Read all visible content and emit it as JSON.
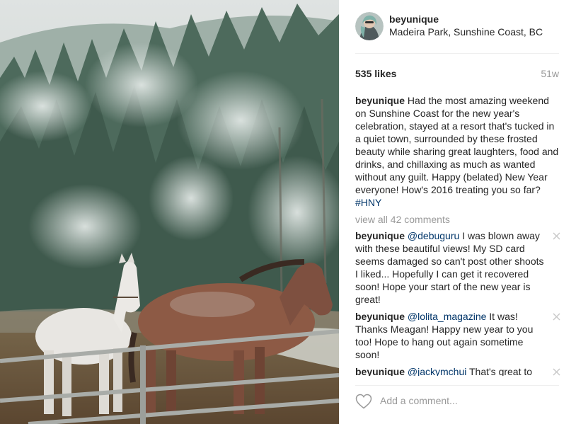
{
  "post": {
    "username": "beyunique",
    "location": "Madeira Park, Sunshine Coast, BC",
    "likes": "535 likes",
    "age": "51w",
    "photo_alt": "Two horses by a fence in front of a frosted forest"
  },
  "caption": {
    "username": "beyunique",
    "text": "Had the most amazing weekend on Sunshine Coast for the new year's celebration, stayed at a resort that's tucked in a quiet town, surrounded by these frosted beauty while sharing great laughters, food and drinks, and chillaxing as much as wanted without any guilt. Happy (belated) New Year everyone! How's 2016 treating you so far?",
    "hashtag": "#HNY"
  },
  "view_all_comments": "view all 42 comments",
  "comments": [
    {
      "username": "beyunique",
      "mention": "@debuguru",
      "text": "I was blown away with these beautiful views! My SD card seems damaged so can't post other shoots I liked... Hopefully I can get it recovered soon! Hope your start of the new year is great!"
    },
    {
      "username": "beyunique",
      "mention": "@lolita_magazine",
      "text": "It was! Thanks Meagan! Happy new year to you too! Hope to hang out again sometime soon!"
    },
    {
      "username": "beyunique",
      "mention": "@jackymchui",
      "text": "That's great to"
    }
  ],
  "add_comment_placeholder": "Add a comment...",
  "icons": {
    "delete": "close-icon",
    "like": "heart-icon"
  },
  "colors": {
    "link": "#003569",
    "muted": "#999999",
    "text": "#262626"
  }
}
